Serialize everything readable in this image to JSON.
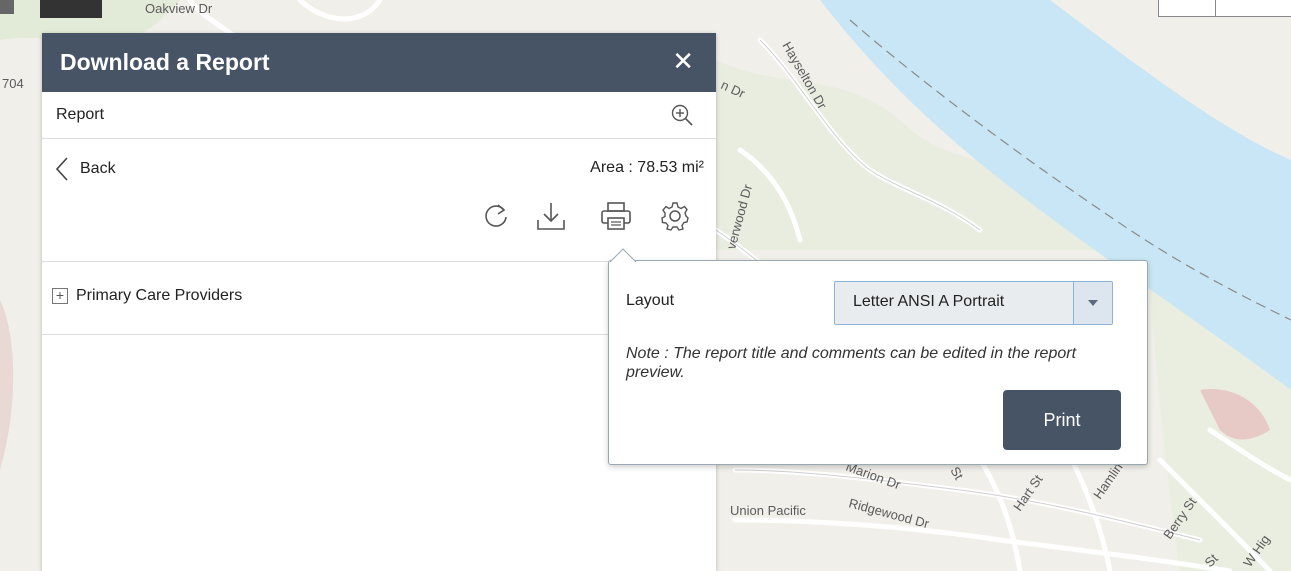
{
  "map": {
    "labels": {
      "oakview": "Oakview Dr",
      "haysel": "Hayselton Dr",
      "n_dr": "n Dr",
      "verwood": "verwood Dr",
      "num704": "704",
      "marion": "Marion Dr",
      "ridgewood": "Ridgewood Dr",
      "union": "Union Pacific",
      "hart": "Hart St",
      "hamlin": "Hamlin",
      "berry": "Berry St",
      "whig": "W Hig",
      "st1": "St",
      "st2": "St"
    },
    "colors": {
      "land": "#f1efe9",
      "water": "#c8e6f5",
      "road": "#ffffff"
    }
  },
  "panel": {
    "title": "Download a Report",
    "close_icon": "close-icon",
    "report_label": "Report",
    "zoom_icon": "zoom-in-icon",
    "back_label": "Back",
    "area_text": "Area : 78.53 mi²",
    "toolbar": [
      "refresh-icon",
      "download-icon",
      "print-icon",
      "settings-icon"
    ],
    "sections": [
      {
        "label": "Primary Care Providers",
        "expand_glyph": "+"
      }
    ],
    "header_color": "#475466"
  },
  "print_popup": {
    "layout_label": "Layout",
    "layout_value": "Letter ANSI A Portrait",
    "note": "Note : The report title and comments can be edited in the report preview.",
    "print_label": "Print",
    "button_color": "#475466"
  }
}
